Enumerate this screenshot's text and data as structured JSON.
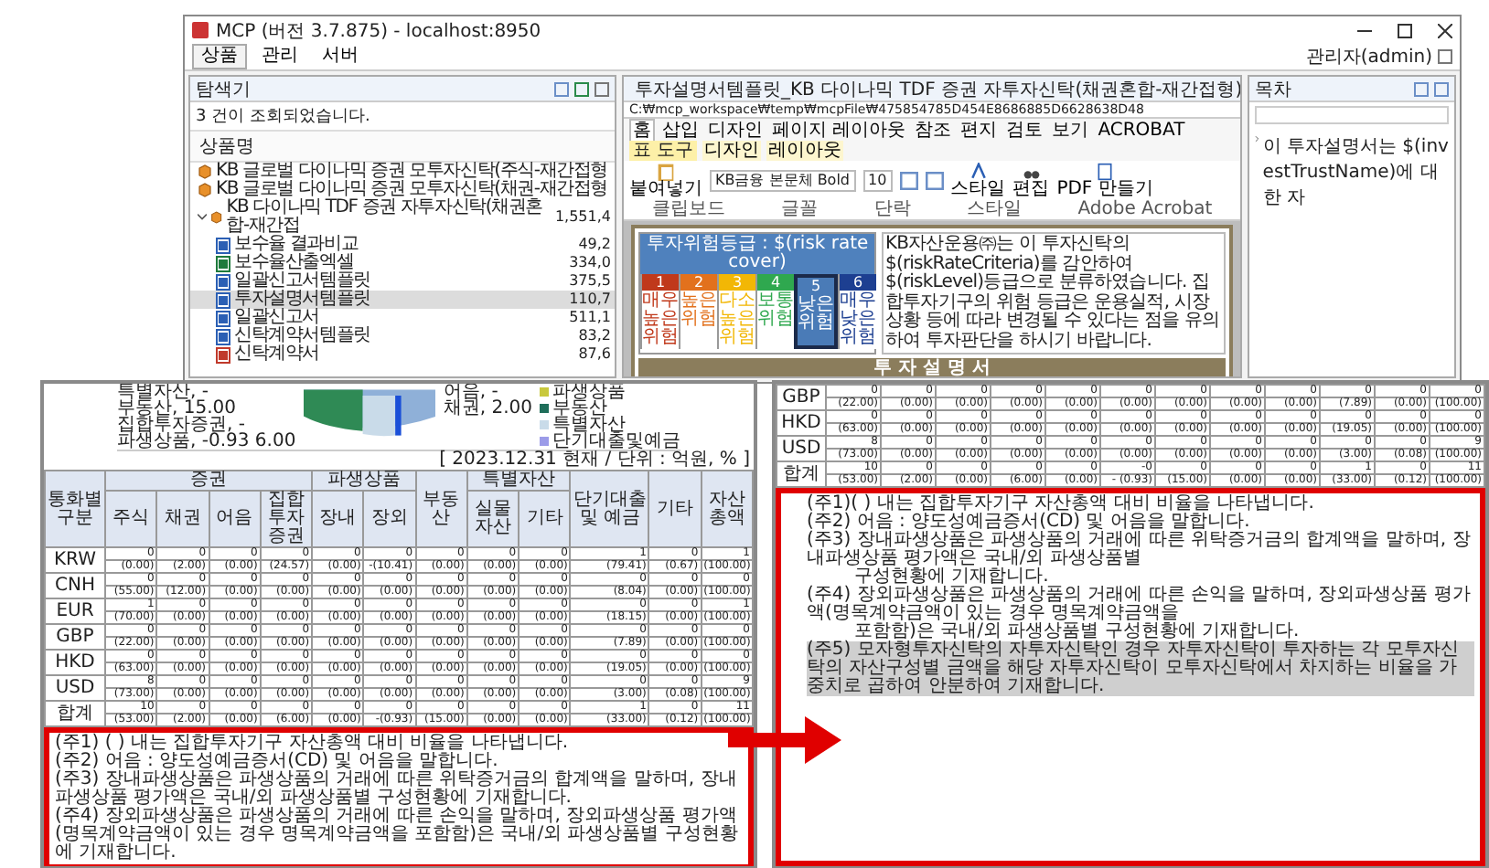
{
  "window": {
    "title": "MCP (버전 3.7.875) - localhost:8950"
  },
  "perspectives": [
    {
      "label": "상품",
      "selected": true
    },
    {
      "label": "관리",
      "selected": false
    },
    {
      "label": "서버",
      "selected": false
    }
  ],
  "user": "관리자(admin)",
  "explorer": {
    "title": "탐색기",
    "status": "3 건이 조회되었습니다.",
    "column": "상품명",
    "items": [
      {
        "label": "KB 글로벌 다이나믹 증권 모투자신탁(주식-재간접형",
        "kind": "fund",
        "selected": false
      },
      {
        "label": "KB 글로벌 다이나믹 증권 모투자신탁(채권-재간접형",
        "kind": "fund",
        "selected": false
      },
      {
        "label": "KB 다이나믹 TDF 증권 자투자신탁(채권혼합-재간접",
        "value": "1,551,4",
        "kind": "fund",
        "expanded": true,
        "selected": false,
        "children": [
          {
            "label": "보수율 결과비교",
            "value": "49,2",
            "kind": "word",
            "selected": false
          },
          {
            "label": "보수율산출엑셀",
            "value": "334,0",
            "kind": "excel",
            "selected": false
          },
          {
            "label": "일괄신고서템플릿",
            "value": "375,5",
            "kind": "word",
            "selected": false
          },
          {
            "label": "투자설명서템플릿",
            "value": "110,7",
            "kind": "word",
            "selected": true
          },
          {
            "label": "일괄신고서",
            "value": "511,1",
            "kind": "word",
            "selected": false
          },
          {
            "label": "신탁계약서템플릿",
            "value": "83,2",
            "kind": "word",
            "selected": false
          },
          {
            "label": "신탁계약서",
            "value": "87,6",
            "kind": "pdf",
            "selected": false
          }
        ]
      }
    ]
  },
  "editor": {
    "tab": "투자설명서템플릿_KB 다이나믹 TDF 증권 자투자신탁(채권혼합-재간접형)",
    "path": "C:₩mcp_workspace₩temp₩mcpFile₩475854785D454E8686885D6628638D48",
    "context_label": "표 도구",
    "ribbon_tabs": [
      {
        "label": "홈",
        "selected": true,
        "kind": "normal"
      },
      {
        "label": "삽입",
        "selected": false,
        "kind": "normal"
      },
      {
        "label": "디자인",
        "selected": false,
        "kind": "normal"
      },
      {
        "label": "페이지 레이아웃",
        "selected": false,
        "kind": "normal"
      },
      {
        "label": "참조",
        "selected": false,
        "kind": "normal"
      },
      {
        "label": "편지",
        "selected": false,
        "kind": "normal"
      },
      {
        "label": "검토",
        "selected": false,
        "kind": "normal"
      },
      {
        "label": "보기",
        "selected": false,
        "kind": "normal"
      },
      {
        "label": "ACROBAT",
        "selected": false,
        "kind": "normal"
      },
      {
        "label": "디자인",
        "selected": false,
        "kind": "context"
      },
      {
        "label": "레이아웃",
        "selected": false,
        "kind": "context"
      }
    ],
    "paste": "붙여넣기",
    "font": "KB금융 본문체 Bold",
    "size": "10",
    "styles": "스타일",
    "edit": "편집",
    "pdf": "PDF 만들기",
    "groups": [
      "클립보드",
      "글꼴",
      "단락",
      "스타일",
      "Adobe Acrobat"
    ]
  },
  "document": {
    "risk_header": "투자위험등급 :",
    "risk_cover": "$(risk rate cover)",
    "levels": [
      {
        "number": "1",
        "label": "매우 높은 위험",
        "color": "#c0391b",
        "selected": false
      },
      {
        "number": "2",
        "label": "높은 위험",
        "color": "#e2711d",
        "selected": false
      },
      {
        "number": "3",
        "label": "다소 높은 위험",
        "color": "#f2b705",
        "selected": false
      },
      {
        "number": "4",
        "label": "보통 위험",
        "color": "#2fa84f",
        "selected": false
      },
      {
        "number": "5",
        "label": "낮은 위험",
        "color": "#4a7bb7",
        "selected": true
      },
      {
        "number": "6",
        "label": "매우 낮은 위험",
        "color": "#1d3f91",
        "selected": false
      }
    ],
    "paragraph": "KB자산운용㈜는 이 투자신탁의 $(riskRateCriteria)를 감안하여 $(riskLevel)등급으로 분류하였습니다. 집합투자기구의 위험 등급은 운용실적, 시장 상황 등에 따라 변경될 수 있다는 점을 유의하여 투자판단을 하시기 바랍니다.",
    "title": "투 자 설 명 서"
  },
  "outline": {
    "title": "목차",
    "item": "이 투자설명서는 $(investTrustName)에 대한 자"
  },
  "left_panel": {
    "pie_labels": [
      "특별자산, -",
      "부동산, 15.00",
      "집합투자증권, -",
      "파생상품, -0.93 6.00",
      "어음, -",
      "채권, 2.00"
    ],
    "legend": [
      {
        "label": "파생상품",
        "color": "#c8c83c"
      },
      {
        "label": "부동산",
        "color": "#1f6e5a"
      },
      {
        "label": "특별자산",
        "color": "#c9dbe9"
      },
      {
        "label": "단기대출및예금",
        "color": "#9b9be8"
      }
    ],
    "date_note": "[ 2023.12.31 현재 / 단위 : 억원, % ]",
    "header_groups": [
      "통화별 구분",
      "증권",
      "파생상품",
      "부동산",
      "특별자산",
      "단기대출 및 예금",
      "기타",
      "자산총액"
    ],
    "columns": [
      "주식",
      "채권",
      "어음",
      "집합투자증권",
      "장내",
      "장외",
      "실물자산",
      "기타"
    ],
    "rows": [
      {
        "currency": "KRW",
        "amounts": [
          "0",
          "0",
          "0",
          "0",
          "0",
          "0",
          "0",
          "0",
          "0",
          "1",
          "0",
          "1"
        ],
        "ratios": [
          "(0.00)",
          "(2.00)",
          "(0.00)",
          "(24.57)",
          "(0.00)",
          "-(10.41)",
          "(0.00)",
          "(0.00)",
          "(0.00)",
          "(79.41)",
          "(0.67)",
          "(100.00)"
        ]
      },
      {
        "currency": "CNH",
        "amounts": [
          "0",
          "0",
          "0",
          "0",
          "0",
          "0",
          "0",
          "0",
          "0",
          "0",
          "0",
          "0"
        ],
        "ratios": [
          "(55.00)",
          "(12.00)",
          "(0.00)",
          "(0.00)",
          "(0.00)",
          "(0.00)",
          "(0.00)",
          "(0.00)",
          "(0.00)",
          "(8.04)",
          "(0.00)",
          "(100.00)"
        ]
      },
      {
        "currency": "EUR",
        "amounts": [
          "1",
          "0",
          "0",
          "0",
          "0",
          "0",
          "0",
          "0",
          "0",
          "0",
          "0",
          "1"
        ],
        "ratios": [
          "(70.00)",
          "(0.00)",
          "(0.00)",
          "(0.00)",
          "(0.00)",
          "(0.00)",
          "(0.00)",
          "(0.00)",
          "(0.00)",
          "(18.15)",
          "(0.00)",
          "(100.00)"
        ]
      },
      {
        "currency": "GBP",
        "amounts": [
          "0",
          "0",
          "0",
          "0",
          "0",
          "0",
          "0",
          "0",
          "0",
          "0",
          "0",
          "0"
        ],
        "ratios": [
          "(22.00)",
          "(0.00)",
          "(0.00)",
          "(0.00)",
          "(0.00)",
          "(0.00)",
          "(0.00)",
          "(0.00)",
          "(0.00)",
          "(7.89)",
          "(0.00)",
          "(100.00)"
        ]
      },
      {
        "currency": "HKD",
        "amounts": [
          "0",
          "0",
          "0",
          "0",
          "0",
          "0",
          "0",
          "0",
          "0",
          "0",
          "0",
          "0"
        ],
        "ratios": [
          "(63.00)",
          "(0.00)",
          "(0.00)",
          "(0.00)",
          "(0.00)",
          "(0.00)",
          "(0.00)",
          "(0.00)",
          "(0.00)",
          "(19.05)",
          "(0.00)",
          "(100.00)"
        ]
      },
      {
        "currency": "USD",
        "amounts": [
          "8",
          "0",
          "0",
          "0",
          "0",
          "0",
          "0",
          "0",
          "0",
          "0",
          "0",
          "9"
        ],
        "ratios": [
          "(73.00)",
          "(0.00)",
          "(0.00)",
          "(0.00)",
          "(0.00)",
          "(0.00)",
          "(0.00)",
          "(0.00)",
          "(0.00)",
          "(3.00)",
          "(0.08)",
          "(100.00)"
        ]
      },
      {
        "currency": "합계",
        "amounts": [
          "10",
          "0",
          "0",
          "0",
          "0",
          "0",
          "0",
          "0",
          "0",
          "1",
          "0",
          "11"
        ],
        "ratios": [
          "(53.00)",
          "(2.00)",
          "(0.00)",
          "(6.00)",
          "(0.00)",
          "-(0.93)",
          "(15.00)",
          "(0.00)",
          "(0.00)",
          "(33.00)",
          "(0.12)",
          "(100.00)"
        ]
      }
    ],
    "notes": [
      "(주1) ( ) 내는 집합투자기구 자산총액 대비 비율을 나타냅니다.",
      "(주2) 어음 : 양도성예금증서(CD) 및 어음을 말합니다.",
      "(주3) 장내파생상품은 파생상품의 거래에 따른 위탁증거금의 합계액을 말하며, 장내파생상품 평가액은 국내/외 파생상품별 구성현황에 기재합니다.",
      "(주4) 장외파생상품은 파생상품의 거래에 따른 손익을 말하며, 장외파생상품 평가액(명목계약금액이 있는 경우 명목계약금액을 포함함)은 국내/외 파생상품별 구성현황에 기재합니다."
    ]
  },
  "right_panel": {
    "rows": [
      {
        "currency": "GBP",
        "amounts": [
          "0",
          "0",
          "0",
          "0",
          "0",
          "0",
          "0",
          "0",
          "0",
          "0",
          "0",
          "0"
        ],
        "ratios": [
          "(22.00)",
          "(0.00)",
          "(0.00)",
          "(0.00)",
          "(0.00)",
          "(0.00)",
          "(0.00)",
          "(0.00)",
          "(0.00)",
          "(7.89)",
          "(0.00)",
          "(100.00)"
        ]
      },
      {
        "currency": "HKD",
        "amounts": [
          "0",
          "0",
          "0",
          "0",
          "0",
          "0",
          "0",
          "0",
          "0",
          "0",
          "0",
          "0"
        ],
        "ratios": [
          "(63.00)",
          "(0.00)",
          "(0.00)",
          "(0.00)",
          "(0.00)",
          "(0.00)",
          "(0.00)",
          "(0.00)",
          "(0.00)",
          "(19.05)",
          "(0.00)",
          "(100.00)"
        ]
      },
      {
        "currency": "USD",
        "amounts": [
          "8",
          "0",
          "0",
          "0",
          "0",
          "0",
          "0",
          "0",
          "0",
          "0",
          "0",
          "9"
        ],
        "ratios": [
          "(73.00)",
          "(0.00)",
          "(0.00)",
          "(0.00)",
          "(0.00)",
          "(0.00)",
          "(0.00)",
          "(0.00)",
          "(0.00)",
          "(3.00)",
          "(0.08)",
          "(100.00)"
        ]
      },
      {
        "currency": "합계",
        "amounts": [
          "10",
          "0",
          "0",
          "0",
          "0",
          "-0",
          "0",
          "0",
          "0",
          "1",
          "0",
          "11"
        ],
        "ratios": [
          "(53.00)",
          "(2.00)",
          "(0.00)",
          "(6.00)",
          "(0.00)",
          "- (0.93)",
          "(15.00)",
          "(0.00)",
          "(0.00)",
          "(33.00)",
          "(0.12)",
          "(100.00)"
        ]
      }
    ],
    "notes": [
      {
        "text": "(주1)( ) 내는 집합투자기구 자산총액 대비 비율을 나타냅니다.",
        "indent": false,
        "highlighted": false
      },
      {
        "text": "(주2) 어음 : 양도성예금증서(CD) 및 어음을 말합니다.",
        "indent": false,
        "highlighted": false
      },
      {
        "text": "(주3) 장내파생상품은 파생상품의 거래에 따른 위탁증거금의 합계액을 말하며, 장내파생상품 평가액은 국내/외 파생상품별",
        "indent": false,
        "highlighted": false
      },
      {
        "text": "구성현황에 기재합니다.",
        "indent": true,
        "highlighted": false
      },
      {
        "text": "(주4) 장외파생상품은 파생상품의 거래에 따른 손익을 말하며, 장외파생상품 평가액(명목계약금액이 있는 경우 명목계약금액을",
        "indent": false,
        "highlighted": false
      },
      {
        "text": "포함함)은 국내/외 파생상품별 구성현황에 기재합니다.",
        "indent": true,
        "highlighted": false
      },
      {
        "text": "(주5) 모자형투자신탁의 자투자신탁인 경우 자투자신탁이 투자하는 각 모투자신탁의 자산구성별 금액을 해당 자투자신탁이 모투자신탁에서 차지하는 비율을 가중치로 곱하여 안분하여 기재합니다.",
        "indent": false,
        "highlighted": true
      }
    ]
  }
}
